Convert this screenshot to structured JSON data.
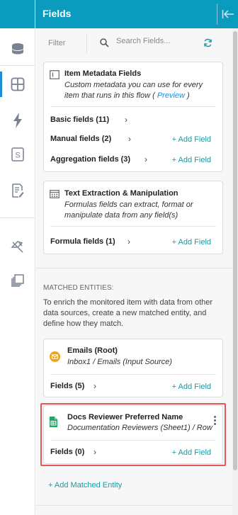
{
  "header": {
    "title": "Fields"
  },
  "sidebar": {
    "icons": [
      "database-icon",
      "grid-icon",
      "bolt-icon",
      "s-box-icon",
      "document-edit-icon",
      "pin-icon",
      "stack-icon"
    ]
  },
  "filter": {
    "label": "Filter",
    "search_placeholder": "Search Fields..."
  },
  "item_metadata": {
    "title": "Item Metadata Fields",
    "desc_prefix": "Custom metadata you can use for every item that runs in this flow ( ",
    "desc_link": "Preview",
    "desc_suffix": " )",
    "rows": [
      {
        "label": "Basic fields (11)",
        "add": ""
      },
      {
        "label": "Manual fields (2)",
        "add": "+ Add Field"
      },
      {
        "label": "Aggregation fields (3)",
        "add": "+ Add Field"
      }
    ]
  },
  "text_extraction": {
    "title": "Text Extraction & Manipulation",
    "desc": "Formulas fields can extract, format or manipulate data from any field(s)",
    "row_label": "Formula fields (1)",
    "add": "+ Add Field"
  },
  "matched": {
    "title": "MATCHED ENTITIES:",
    "desc": "To enrich the monitored item with data from other data sources, create a new matched entity, and define how they match.",
    "emails": {
      "title": "Emails (Root)",
      "subtitle": "Inbox1 / Emails (Input Source)",
      "row_label": "Fields (5)",
      "add": "+ Add Field"
    },
    "docs": {
      "title": "Docs Reviewer Preferred Name",
      "subtitle": "Documentation Reviewers (Sheet1) / Row",
      "row_label": "Fields (0)",
      "add": "+ Add Field"
    },
    "add_entity": "+ Add Matched Entity"
  },
  "colors": {
    "header_bg": "#0a9bbf",
    "accent_link": "#1a9aa3",
    "highlight": "#e4575b"
  }
}
